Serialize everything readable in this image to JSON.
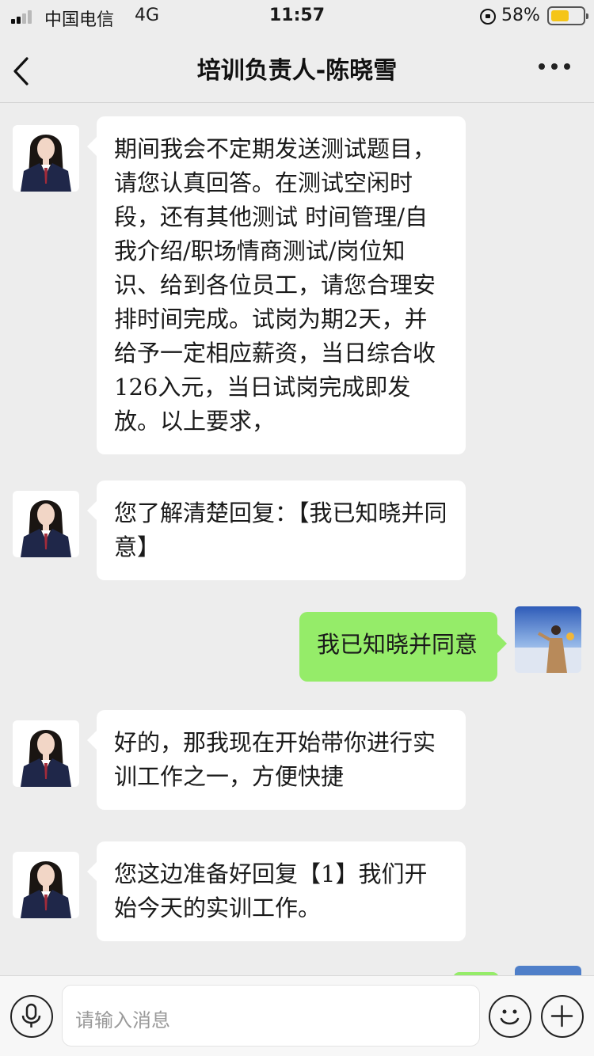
{
  "status_bar": {
    "carrier": "中国电信",
    "network": "4G",
    "time": "11:57",
    "battery_percent": "58%",
    "battery_level": 0.58,
    "battery_color": "#f5c518"
  },
  "header": {
    "title": "培训负责人-陈晓雪",
    "back_icon": "chevron-left-icon",
    "more_icon": "more-dots-icon"
  },
  "messages": [
    {
      "sender": "contact",
      "text": "期间我会不定期发送测试题目，请您认真回答。在测试空闲时段，还有其他测试 时间管理/自我介绍/职场情商测试/岗位知识、给到各位员工，请您合理安排时间完成。试岗为期2天，并给予一定相应薪资，当日综合收126入元，当日试岗完成即发放。以上要求，"
    },
    {
      "sender": "contact",
      "text": "您了解清楚回复：【我已知晓并同意】"
    },
    {
      "sender": "me",
      "text": "我已知晓并同意"
    },
    {
      "sender": "contact",
      "text": "好的，那我现在开始带你进行实训工作之一，方便快捷"
    },
    {
      "sender": "contact",
      "text": "您这边准备好回复【1】我们开始今天的实训工作。"
    }
  ],
  "input_bar": {
    "placeholder": "请输入消息",
    "voice_icon": "microphone-icon",
    "emoji_icon": "smiley-icon",
    "plus_icon": "plus-icon"
  },
  "colors": {
    "background": "#ededed",
    "bubble_contact": "#ffffff",
    "bubble_me": "#95ec69"
  }
}
